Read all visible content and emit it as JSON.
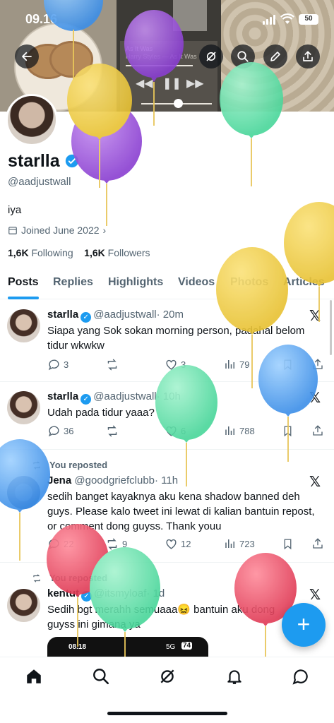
{
  "status_bar": {
    "time": "09.16",
    "battery": "50"
  },
  "banner": {
    "player_title": "As It Was",
    "player_artist": "Harry Styles — As It Was"
  },
  "profile": {
    "name": "starlla",
    "handle": "@aadjustwall",
    "bio": "iya",
    "joined": "Joined June 2022",
    "following_count": "1,6K",
    "following_label": "Following",
    "followers_count": "1,6K",
    "followers_label": "Followers"
  },
  "tabs": [
    "Posts",
    "Replies",
    "Highlights",
    "Videos",
    "Photos",
    "Articles"
  ],
  "posts": [
    {
      "name": "starlla",
      "handle": "@aadjustwall",
      "time": "· 20m",
      "text": "Siapa yang Sok sokan morning person, padahal belom tidur wkwkw",
      "replies": "3",
      "reposts": "",
      "likes": "3",
      "views": "79"
    },
    {
      "name": "starlla",
      "handle": "@aadjustwall",
      "time": "· 10h",
      "text": "Udah pada tidur yaaa?",
      "replies": "36",
      "reposts": "",
      "likes": "6",
      "views": "788"
    },
    {
      "repost_label": "You reposted",
      "name": "Jena",
      "handle": "@goodgriefclubb",
      "time": "· 11h",
      "text": "sedih banget kayaknya aku kena shadow banned deh guys. Please kalo tweet ini lewat di kalian bantuin repost, or comment dong guyss. Thank youu",
      "replies": "22",
      "reposts": "9",
      "likes": "12",
      "views": "723"
    },
    {
      "repost_label": "You reposted",
      "name": "kentut",
      "handle": "@itsmyloaf",
      "time": "· 1d",
      "text": "Sedih bgt merahh semuaaa😖 bantuin aku dong guyss ini gimana ya",
      "embed_time": "08.18",
      "embed_signal": "5G",
      "embed_battery": "74"
    }
  ],
  "fab_label": "+",
  "colors": {
    "accent": "#1d9bf0",
    "text": "#0f1419",
    "muted": "#536471"
  },
  "icons": [
    "back-arrow-icon",
    "grok-icon",
    "search-icon",
    "edit-icon",
    "share-icon",
    "calendar-icon",
    "verified-icon",
    "reply-icon",
    "repost-icon",
    "like-icon",
    "views-icon",
    "bookmark-icon",
    "x-logo-icon",
    "home-icon",
    "explore-icon",
    "notifications-icon",
    "messages-icon"
  ]
}
